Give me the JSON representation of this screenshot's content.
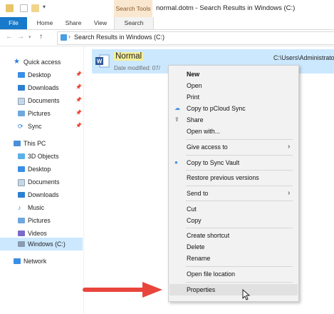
{
  "titlebar": {
    "search_tools": "Search Tools",
    "window_title": "normal.dotm - Search Results in Windows (C:)"
  },
  "ribbon": {
    "tabs": [
      "File",
      "Home",
      "Share",
      "View",
      "Search"
    ]
  },
  "address": {
    "path": "Search Results in Windows (C:)"
  },
  "sidebar": {
    "quick_access": "Quick access",
    "quick_items": [
      "Desktop",
      "Downloads",
      "Documents",
      "Pictures",
      "Sync"
    ],
    "this_pc": "This PC",
    "pc_items": [
      "3D Objects",
      "Desktop",
      "Documents",
      "Downloads",
      "Music",
      "Pictures",
      "Videos",
      "Windows (C:)"
    ],
    "network": "Network"
  },
  "result": {
    "name": "Normal",
    "date": "Date modified: 07/",
    "path": "C:\\Users\\Administrato"
  },
  "menu": {
    "new": "New",
    "open": "Open",
    "print": "Print",
    "copy_pcloud": "Copy to pCloud Sync",
    "share": "Share",
    "open_with": "Open with...",
    "give_access": "Give access to",
    "copy_vault": "Copy to Sync Vault",
    "restore": "Restore previous versions",
    "send_to": "Send to",
    "cut": "Cut",
    "copy": "Copy",
    "create_shortcut": "Create shortcut",
    "delete": "Delete",
    "rename": "Rename",
    "open_location": "Open file location",
    "properties": "Properties"
  },
  "colors": {
    "accent": "#1979ca",
    "selection": "#cce8ff",
    "search_tools_bg": "#f9e7cf",
    "arrow": "#e8453c"
  }
}
